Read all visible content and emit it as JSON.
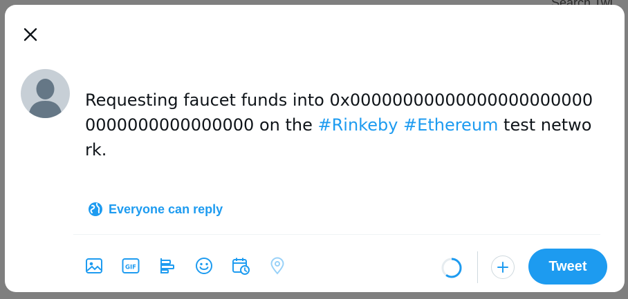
{
  "background": {
    "search_label": "Search Twi"
  },
  "composer": {
    "tweet_text_prefix": "Requesting faucet funds into 0x000000000000000000000000000000000000000 on the ",
    "hashtag_1": "#Rinkeby",
    "hashtag_2": "#Ethereum",
    "tweet_text_suffix": " test network.",
    "reply_setting": "Everyone can reply",
    "tweet_button": "Tweet"
  },
  "toolbar": {
    "icons": [
      "image-icon",
      "gif-icon",
      "poll-icon",
      "emoji-icon",
      "schedule-icon",
      "location-icon"
    ]
  },
  "colors": {
    "accent": "#1d9bf0",
    "text": "#0f1419",
    "overlay": "#7f7f7f",
    "avatar_bg": "#c7cfd6"
  }
}
